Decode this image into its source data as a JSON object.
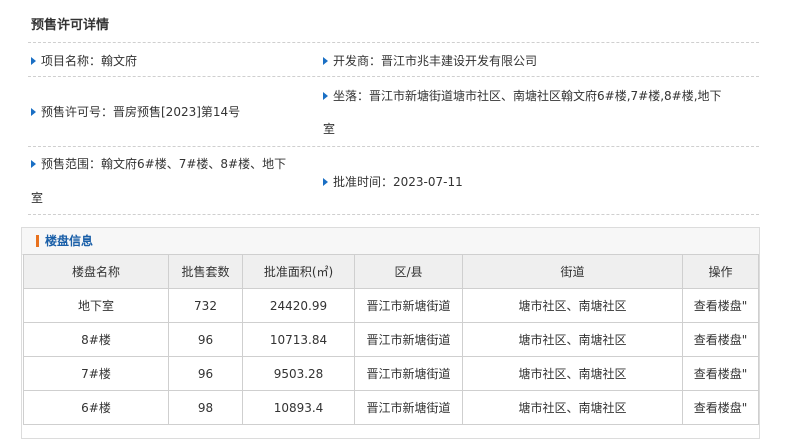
{
  "page": {
    "title": "预售许可详情"
  },
  "info": {
    "project_name": "项目名称：翰文府",
    "developer": "开发商：晋江市兆丰建设开发有限公司",
    "permit_no": "预售许可号：晋房预售[2023]第14号",
    "location_line1": "坐落：晋江市新塘街道塘市社区、南塘社区翰文府6#楼,7#楼,8#楼,地下",
    "location_line2": "室",
    "scope_line1": "预售范围：翰文府6#楼、7#楼、8#楼、地下",
    "scope_line2": "室",
    "approval_date": "批准时间：2023-07-11"
  },
  "panel": {
    "title": "楼盘信息"
  },
  "table": {
    "headers": [
      "楼盘名称",
      "批售套数",
      "批准面积(㎡)",
      "区/县",
      "街道",
      "操作"
    ],
    "rows": [
      [
        "地下室",
        "732",
        "24420.99",
        "晋江市新塘街道",
        "塘市社区、南塘社区",
        "查看楼盘\""
      ],
      [
        "8#楼",
        "96",
        "10713.84",
        "晋江市新塘街道",
        "塘市社区、南塘社区",
        "查看楼盘\""
      ],
      [
        "7#楼",
        "96",
        "9503.28",
        "晋江市新塘街道",
        "塘市社区、南塘社区",
        "查看楼盘\""
      ],
      [
        "6#楼",
        "98",
        "10893.4",
        "晋江市新塘街道",
        "塘市社区、南塘社区",
        "查看楼盘\""
      ]
    ]
  },
  "colors": {
    "accent_blue": "#1a6fc4",
    "panel_bar": "#e8711e",
    "panel_title": "#1a5fa8"
  }
}
